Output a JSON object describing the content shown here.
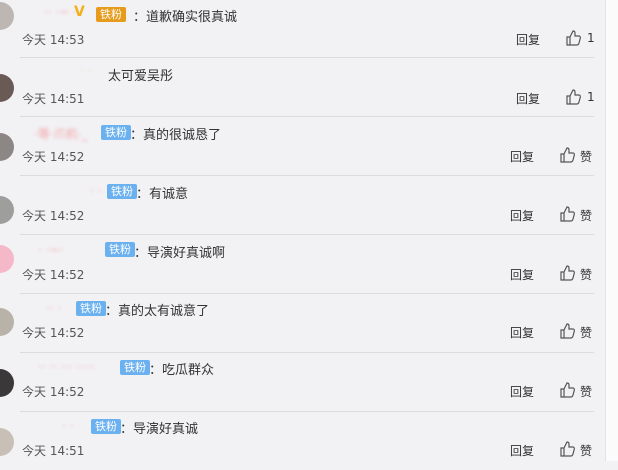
{
  "comments": [
    {
      "nick": "·· ·~ ·",
      "badge": "铁粉",
      "text": "：道歉确实很真诚",
      "time": "今天 14:53",
      "reply": "回复",
      "likes": "1"
    },
    {
      "nick": "· ·",
      "badge": "",
      "text": "太可爱吴彤",
      "time": "今天 14:51",
      "reply": "回复",
      "likes": "1"
    },
    {
      "nick": "·等·爪机·_",
      "badge": "铁粉",
      "text": "：真的很诚恳了",
      "time": "今天 14:52",
      "reply": "回复",
      "likes": "赞"
    },
    {
      "nick": "· ·",
      "badge": "铁粉",
      "text": "：有诚意",
      "time": "今天 14:52",
      "reply": "回复",
      "likes": "赞"
    },
    {
      "nick": "· ·~·",
      "badge": "铁粉",
      "text": "：导演好真诚啊",
      "time": "今天 14:52",
      "reply": "回复",
      "likes": "赞"
    },
    {
      "nick": "·· ·",
      "badge": "铁粉",
      "text": "：真的太有诚意了",
      "time": "今天 14:52",
      "reply": "回复",
      "likes": "赞"
    },
    {
      "nick": "·· ·· ··· ·····",
      "badge": "铁粉",
      "text": "：吃瓜群众",
      "time": "今天 14:52",
      "reply": "回复",
      "likes": "赞"
    },
    {
      "nick": "· ·",
      "badge": "铁粉",
      "text": "：导演好真诚",
      "time": "今天 14:51",
      "reply": "回复",
      "likes": "赞"
    }
  ]
}
